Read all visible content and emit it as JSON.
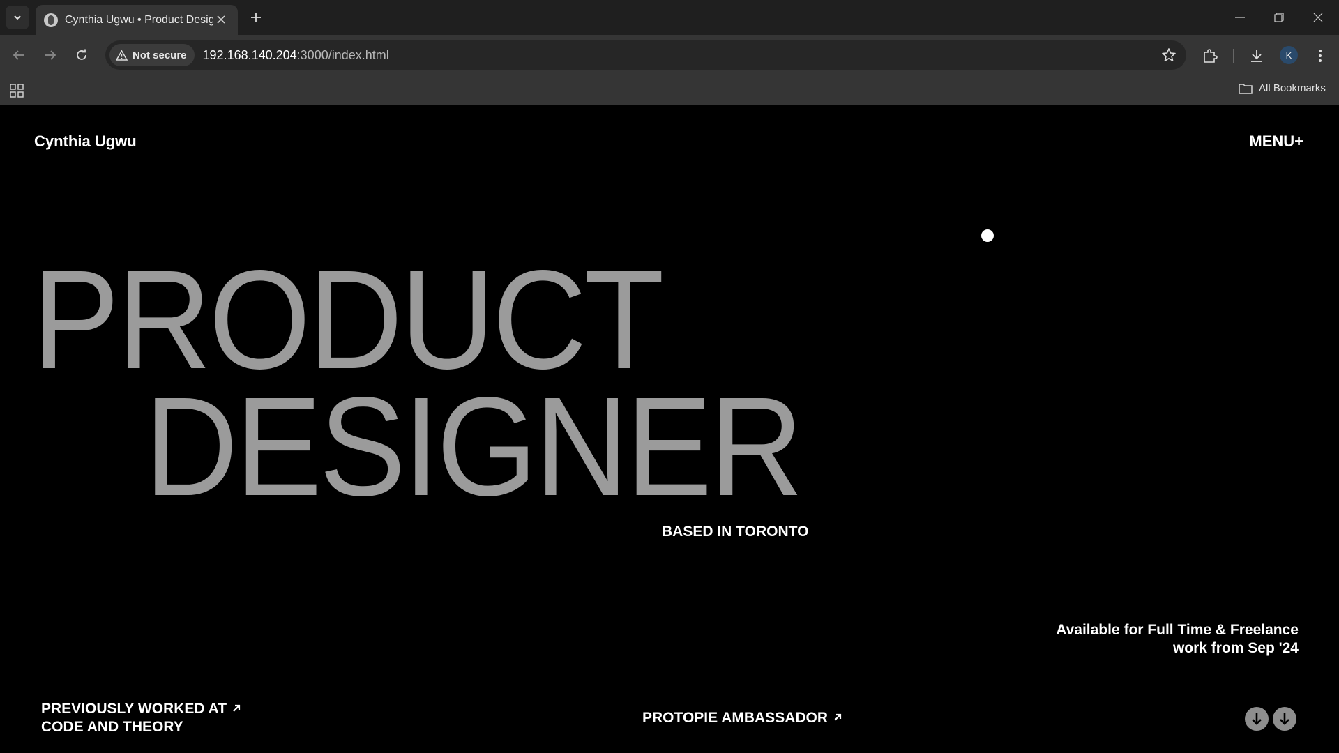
{
  "browser": {
    "tab_title": "Cynthia Ugwu • Product Design",
    "security_label": "Not secure",
    "url_host": "192.168.140.204",
    "url_rest": ":3000/index.html",
    "profile_initial": "K",
    "all_bookmarks": "All Bookmarks"
  },
  "site": {
    "brand": "Cynthia Ugwu",
    "menu": "MENU+",
    "hero_line1": "PRODUCT",
    "hero_line2": "DESIGNER",
    "based": "BASED IN TORONTO",
    "available_line1": "Available for Full Time & Freelance",
    "available_line2": "work from Sep '24",
    "worked_line1": "PREVIOUSLY WORKED AT",
    "worked_line2": "CODE AND THEORY",
    "ambassador": "PROTOPIE AMBASSADOR"
  },
  "colors": {
    "page_bg": "#000000",
    "hero_text": "#9b9b9b",
    "chrome_bg": "#1f1f1f",
    "toolbar_bg": "#353535"
  },
  "icons": [
    "tab-search-icon",
    "favicon-icon",
    "close-icon",
    "plus-icon",
    "minimize-icon",
    "restore-icon",
    "close-window-icon",
    "back-icon",
    "forward-icon",
    "reload-icon",
    "warning-icon",
    "star-icon",
    "extensions-icon",
    "download-icon",
    "more-icon",
    "apps-icon",
    "folder-icon",
    "arrow-up-right-icon",
    "arrow-down-icon"
  ]
}
